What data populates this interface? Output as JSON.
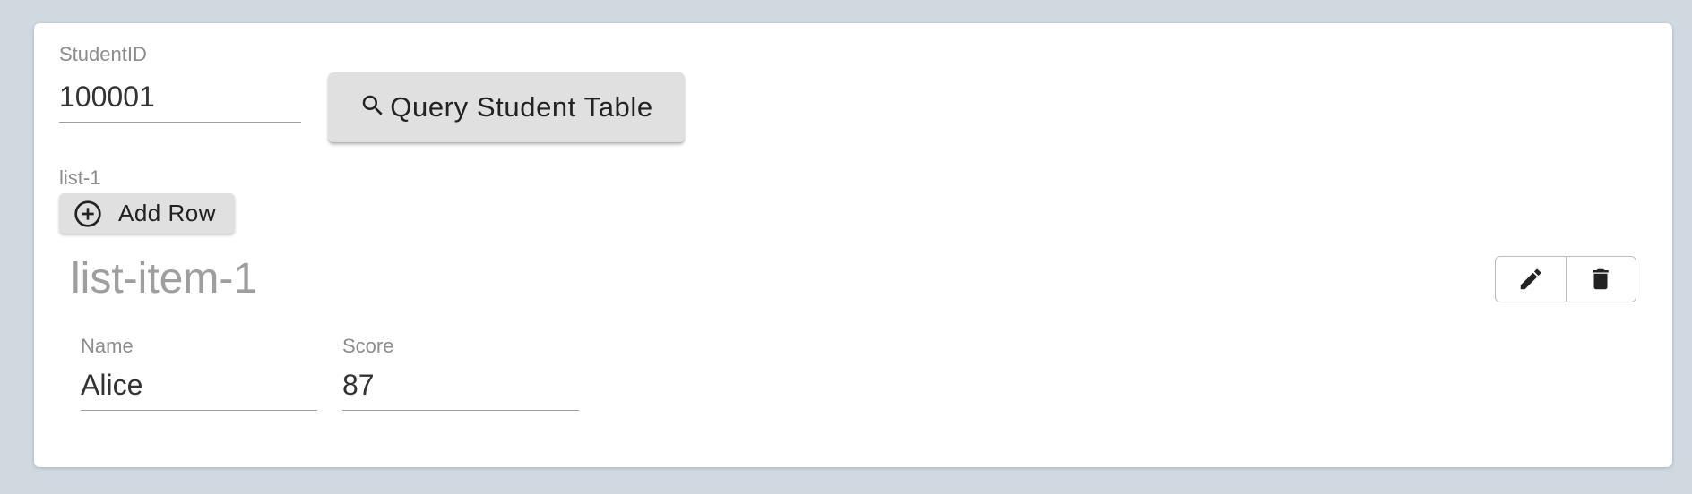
{
  "form": {
    "student_id": {
      "label": "StudentID",
      "value": "100001"
    },
    "query_button": {
      "label": "Query Student Table",
      "icon": "search-icon"
    },
    "list": {
      "label": "list-1",
      "add_button": {
        "label": "Add Row",
        "icon": "add-circle-icon"
      },
      "items": [
        {
          "title": "list-item-1",
          "name": {
            "label": "Name",
            "value": "Alice"
          },
          "score": {
            "label": "Score",
            "value": "87"
          },
          "actions": {
            "edit_icon": "pencil-icon",
            "delete_icon": "trash-icon"
          }
        }
      ]
    }
  },
  "colors": {
    "page_background": "#cfd9df",
    "card_background": "#ffffff",
    "button_background": "#e0e0e0",
    "label_text": "#8c8c8c",
    "value_text": "#333333"
  }
}
